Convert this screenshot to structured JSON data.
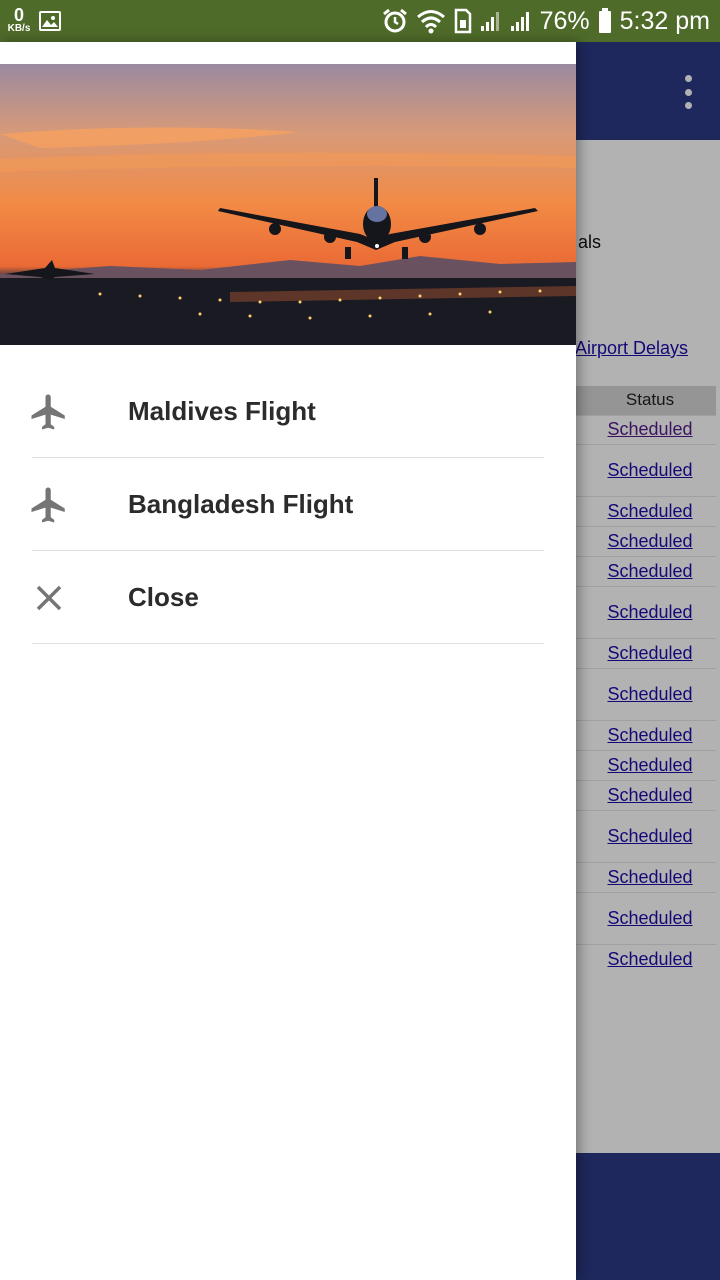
{
  "status_bar": {
    "speed_value": "0",
    "speed_unit": "KB/s",
    "battery": "76%",
    "time": "5:32 pm"
  },
  "app": {
    "partial_text": "als",
    "delays_link": "Airport Delays",
    "table": {
      "header": "Status",
      "rows": [
        "Scheduled",
        "Scheduled",
        "Scheduled",
        "Scheduled",
        "Scheduled",
        "Scheduled",
        "Scheduled",
        "Scheduled",
        "Scheduled",
        "Scheduled",
        "Scheduled",
        "Scheduled",
        "Scheduled",
        "Scheduled",
        "Scheduled"
      ]
    }
  },
  "drawer": {
    "items": [
      {
        "label": "Maldives Flight",
        "icon": "airplane-icon"
      },
      {
        "label": "Bangladesh Flight",
        "icon": "airplane-icon"
      },
      {
        "label": "Close",
        "icon": "close-icon"
      }
    ]
  },
  "colors": {
    "status_bar": "#4f6b2a",
    "app_bar": "#2c3a85",
    "link": "#1a0dab"
  }
}
